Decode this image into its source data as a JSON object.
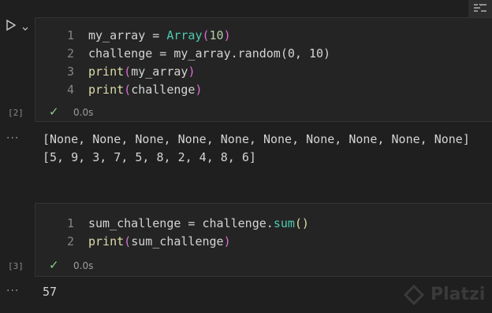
{
  "toolbar": {
    "run_icon": "run-triangle-icon",
    "chevron_icon": "chevron-down-icon",
    "outline_icon": "outline-list-icon"
  },
  "cells": [
    {
      "exec_count": "[2]",
      "duration": "0.0s",
      "lines": [
        {
          "num": "1",
          "tokens": [
            [
              "my_array",
              "default"
            ],
            [
              " = ",
              "default"
            ],
            [
              "Array",
              "teal"
            ],
            [
              "(",
              "pink"
            ],
            [
              "10",
              "num"
            ],
            [
              ")",
              "pink"
            ]
          ]
        },
        {
          "num": "2",
          "tokens": [
            [
              "challenge",
              "default"
            ],
            [
              " = ",
              "default"
            ],
            [
              "my_array",
              "default"
            ],
            [
              ".random(0, 10)",
              "default"
            ]
          ]
        },
        {
          "num": "3",
          "tokens": [
            [
              "print",
              "yellow"
            ],
            [
              "(",
              "pink"
            ],
            [
              "my_array",
              "default"
            ],
            [
              ")",
              "pink"
            ]
          ]
        },
        {
          "num": "4",
          "tokens": [
            [
              "print",
              "yellow"
            ],
            [
              "(",
              "pink"
            ],
            [
              "challenge",
              "default"
            ],
            [
              ")",
              "pink"
            ]
          ]
        }
      ],
      "output": [
        "[None, None, None, None, None, None, None, None, None, None]",
        "[5, 9, 3, 7, 5, 8, 2, 4, 8, 6]"
      ]
    },
    {
      "exec_count": "[3]",
      "duration": "0.0s",
      "lines": [
        {
          "num": "1",
          "tokens": [
            [
              "sum_challenge",
              "default"
            ],
            [
              " = ",
              "default"
            ],
            [
              "challenge",
              "default"
            ],
            [
              ".",
              "default"
            ],
            [
              "sum",
              "teal"
            ],
            [
              "()",
              "yellow"
            ]
          ]
        },
        {
          "num": "2",
          "tokens": [
            [
              "print",
              "yellow"
            ],
            [
              "(",
              "pink"
            ],
            [
              "sum_challenge",
              "default"
            ],
            [
              ")",
              "pink"
            ]
          ]
        }
      ],
      "output": [
        "57"
      ]
    }
  ],
  "status": {
    "check_symbol": "✓",
    "more_symbol": "···"
  },
  "watermark": {
    "text": "Platzi"
  }
}
